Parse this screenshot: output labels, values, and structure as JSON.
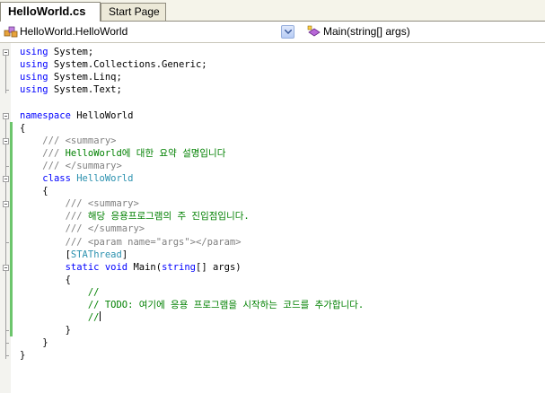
{
  "tabs": [
    {
      "label": "HelloWorld.cs",
      "active": true
    },
    {
      "label": "Start Page",
      "active": false
    }
  ],
  "navbar": {
    "type_selector": "HelloWorld.HelloWorld",
    "member_selector": "Main(string[] args)"
  },
  "code": [
    {
      "segs": [
        {
          "t": "using",
          "c": "kw"
        },
        {
          "t": " System;"
        }
      ]
    },
    {
      "segs": [
        {
          "t": "using",
          "c": "kw"
        },
        {
          "t": " System.Collections.Generic;"
        }
      ]
    },
    {
      "segs": [
        {
          "t": "using",
          "c": "kw"
        },
        {
          "t": " System.Linq;"
        }
      ]
    },
    {
      "segs": [
        {
          "t": "using",
          "c": "kw"
        },
        {
          "t": " System.Text;"
        }
      ]
    },
    {
      "segs": []
    },
    {
      "segs": [
        {
          "t": "namespace",
          "c": "kw"
        },
        {
          "t": " HelloWorld"
        }
      ]
    },
    {
      "segs": [
        {
          "t": "{"
        }
      ]
    },
    {
      "segs": [
        {
          "t": "    "
        },
        {
          "t": "///",
          "c": "doc"
        },
        {
          "t": " ",
          "c": "cm"
        },
        {
          "t": "<summary>",
          "c": "doc"
        }
      ]
    },
    {
      "segs": [
        {
          "t": "    "
        },
        {
          "t": "///",
          "c": "doc"
        },
        {
          "t": " HelloWorld에 대한 요약 설명입니다",
          "c": "cm"
        }
      ]
    },
    {
      "segs": [
        {
          "t": "    "
        },
        {
          "t": "///",
          "c": "doc"
        },
        {
          "t": " ",
          "c": "cm"
        },
        {
          "t": "</summary>",
          "c": "doc"
        }
      ]
    },
    {
      "segs": [
        {
          "t": "    "
        },
        {
          "t": "class",
          "c": "kw"
        },
        {
          "t": " "
        },
        {
          "t": "HelloWorld",
          "c": "ty"
        }
      ]
    },
    {
      "segs": [
        {
          "t": "    {"
        }
      ]
    },
    {
      "segs": [
        {
          "t": "        "
        },
        {
          "t": "///",
          "c": "doc"
        },
        {
          "t": " ",
          "c": "cm"
        },
        {
          "t": "<summary>",
          "c": "doc"
        }
      ]
    },
    {
      "segs": [
        {
          "t": "        "
        },
        {
          "t": "///",
          "c": "doc"
        },
        {
          "t": " 해당 응용프로그램의 주 진입점입니다.",
          "c": "cm"
        }
      ]
    },
    {
      "segs": [
        {
          "t": "        "
        },
        {
          "t": "///",
          "c": "doc"
        },
        {
          "t": " ",
          "c": "cm"
        },
        {
          "t": "</summary>",
          "c": "doc"
        }
      ]
    },
    {
      "segs": [
        {
          "t": "        "
        },
        {
          "t": "///",
          "c": "doc"
        },
        {
          "t": " ",
          "c": "cm"
        },
        {
          "t": "<param name=\"args\"></param>",
          "c": "doc"
        }
      ]
    },
    {
      "segs": [
        {
          "t": "        ["
        },
        {
          "t": "STAThread",
          "c": "ty"
        },
        {
          "t": "]"
        }
      ]
    },
    {
      "segs": [
        {
          "t": "        "
        },
        {
          "t": "static",
          "c": "kw"
        },
        {
          "t": " "
        },
        {
          "t": "void",
          "c": "kw"
        },
        {
          "t": " Main("
        },
        {
          "t": "string",
          "c": "kw"
        },
        {
          "t": "[] args)"
        }
      ]
    },
    {
      "segs": [
        {
          "t": "        {"
        }
      ]
    },
    {
      "segs": [
        {
          "t": "            "
        },
        {
          "t": "//",
          "c": "cm"
        }
      ]
    },
    {
      "segs": [
        {
          "t": "            "
        },
        {
          "t": "// TODO: 여기에 응용 프로그램을 시작하는 코드를 추가합니다.",
          "c": "cm"
        }
      ]
    },
    {
      "segs": [
        {
          "t": "            "
        },
        {
          "t": "//",
          "c": "cm"
        }
      ],
      "caret": true
    },
    {
      "segs": [
        {
          "t": "        }"
        }
      ]
    },
    {
      "segs": [
        {
          "t": "    }"
        }
      ]
    },
    {
      "segs": [
        {
          "t": "}"
        }
      ]
    }
  ]
}
